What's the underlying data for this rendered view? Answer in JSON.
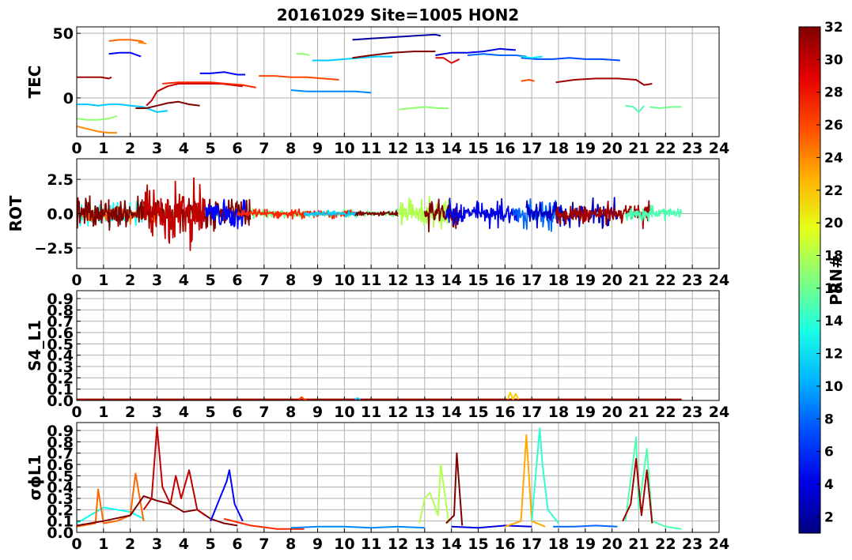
{
  "title": "20161029 Site=1005 HON2",
  "colorbar": {
    "label": "PRN#",
    "min": 1,
    "max": 32,
    "ticks": [
      "2",
      "4",
      "6",
      "8",
      "10",
      "12",
      "14",
      "16",
      "18",
      "20",
      "22",
      "24",
      "26",
      "28",
      "30",
      "32"
    ],
    "colormap": "jet"
  },
  "chart_data": [
    {
      "type": "line",
      "ylabel": "TEC",
      "xlim": [
        0,
        24
      ],
      "ylim": [
        -30,
        55
      ],
      "xticks": [
        "0",
        "1",
        "2",
        "3",
        "4",
        "5",
        "6",
        "7",
        "8",
        "9",
        "10",
        "11",
        "12",
        "13",
        "14",
        "15",
        "16",
        "17",
        "18",
        "19",
        "20",
        "21",
        "22",
        "23",
        "24"
      ],
      "yticks": [
        {
          "v": 50,
          "label": "50"
        },
        {
          "v": 0,
          "label": "0"
        }
      ],
      "grid": true,
      "series": [
        {
          "prn": 31,
          "x": [
            0.0,
            0.3,
            0.6,
            0.9,
            1.2,
            1.3
          ],
          "y": [
            16,
            16,
            16,
            16,
            15,
            16
          ]
        },
        {
          "prn": 11,
          "x": [
            0.0,
            0.4,
            0.8,
            1.2,
            1.6,
            2.0,
            2.5,
            3.0,
            3.4
          ],
          "y": [
            -5,
            -5,
            -6,
            -5,
            -5,
            -6,
            -7,
            -11,
            -10
          ]
        },
        {
          "prn": 17,
          "x": [
            0.0,
            0.4,
            0.8,
            1.2,
            1.5
          ],
          "y": [
            -16,
            -17,
            -17,
            -16,
            -14
          ]
        },
        {
          "prn": 24,
          "x": [
            0.0,
            0.4,
            0.8,
            1.2,
            1.5
          ],
          "y": [
            -22,
            -24,
            -26,
            -27,
            -27
          ]
        },
        {
          "prn": 25,
          "x": [
            1.2,
            1.6,
            2.0,
            2.4,
            2.5
          ],
          "y": [
            44,
            45,
            45,
            44,
            43
          ]
        },
        {
          "prn": 24,
          "x": [
            2.3,
            2.6
          ],
          "y": [
            43,
            42
          ]
        },
        {
          "prn": 5,
          "x": [
            1.2,
            1.6,
            2.0,
            2.4
          ],
          "y": [
            34,
            35,
            35,
            32
          ]
        },
        {
          "prn": 30,
          "x": [
            2.6,
            2.8,
            3.0,
            3.4,
            3.8,
            4.2,
            4.6,
            5.0,
            5.4,
            5.8,
            6.2
          ],
          "y": [
            -6,
            -2,
            5,
            9,
            11,
            11,
            11,
            11,
            11,
            10,
            9
          ]
        },
        {
          "prn": 32,
          "x": [
            2.2,
            2.6,
            3.0,
            3.4,
            3.8,
            4.2,
            4.6
          ],
          "y": [
            -8,
            -8,
            -6,
            -4,
            -3,
            -5,
            -6
          ]
        },
        {
          "prn": 27,
          "x": [
            3.2,
            3.8,
            4.4,
            5.0,
            5.6,
            6.2,
            6.7
          ],
          "y": [
            11,
            12,
            12,
            12,
            11,
            10,
            8
          ]
        },
        {
          "prn": 5,
          "x": [
            4.6,
            5.0,
            5.5,
            6.0,
            6.3
          ],
          "y": [
            19,
            19,
            20,
            18,
            18
          ]
        },
        {
          "prn": 26,
          "x": [
            6.8,
            7.4,
            8.0,
            8.6,
            9.2,
            9.8
          ],
          "y": [
            17,
            17,
            16,
            16,
            15,
            14
          ]
        },
        {
          "prn": 9,
          "x": [
            8.0,
            8.6,
            9.2,
            9.8,
            10.4,
            11.0
          ],
          "y": [
            6,
            5,
            5,
            5,
            5,
            4
          ]
        },
        {
          "prn": 17,
          "x": [
            8.2,
            8.5,
            8.7
          ],
          "y": [
            34,
            34,
            33
          ]
        },
        {
          "prn": 11,
          "x": [
            8.8,
            9.4,
            10.0,
            10.6,
            11.2,
            11.8
          ],
          "y": [
            29,
            29,
            30,
            31,
            32,
            32
          ]
        },
        {
          "prn": 2,
          "x": [
            10.3,
            11.0,
            11.8,
            12.6,
            13.4,
            13.6
          ],
          "y": [
            45,
            46,
            47,
            48,
            49,
            48
          ]
        },
        {
          "prn": 32,
          "x": [
            10.3,
            11.0,
            11.8,
            12.6,
            13.4
          ],
          "y": [
            31,
            33,
            35,
            36,
            36
          ]
        },
        {
          "prn": 29,
          "x": [
            13.4,
            13.7,
            14.0,
            14.3
          ],
          "y": [
            31,
            31,
            27,
            30
          ]
        },
        {
          "prn": 4,
          "x": [
            13.4,
            14.0,
            14.6,
            15.2,
            15.8,
            16.4
          ],
          "y": [
            33,
            35,
            35,
            36,
            38,
            37
          ]
        },
        {
          "prn": 8,
          "x": [
            14.6,
            15.2,
            15.8,
            16.4,
            16.8
          ],
          "y": [
            33,
            34,
            33,
            33,
            32
          ]
        },
        {
          "prn": 7,
          "x": [
            16.6,
            17.2,
            17.8,
            18.4,
            19.0,
            19.6,
            20.3
          ],
          "y": [
            31,
            30,
            30,
            31,
            30,
            30,
            29
          ]
        },
        {
          "prn": 12,
          "x": [
            16.6,
            17.0,
            17.4
          ],
          "y": [
            32,
            31,
            32
          ]
        },
        {
          "prn": 17,
          "x": [
            12.0,
            12.5,
            13.0,
            13.5,
            13.9
          ],
          "y": [
            -9,
            -8,
            -7,
            -8,
            -8
          ]
        },
        {
          "prn": 26,
          "x": [
            16.6,
            16.9,
            17.1
          ],
          "y": [
            13,
            14,
            13
          ]
        },
        {
          "prn": 31,
          "x": [
            17.9,
            18.6,
            19.4,
            20.2,
            20.9,
            21.2,
            21.5
          ],
          "y": [
            12,
            14,
            15,
            15,
            14,
            10,
            11
          ]
        },
        {
          "prn": 15,
          "x": [
            20.5,
            20.8,
            21.0,
            21.2
          ],
          "y": [
            -6,
            -7,
            -11,
            -6
          ]
        },
        {
          "prn": 16,
          "x": [
            21.4,
            21.8,
            22.2,
            22.6
          ],
          "y": [
            -7,
            -8,
            -7,
            -7
          ]
        }
      ]
    },
    {
      "type": "line",
      "ylabel": "ROT",
      "xlim": [
        0,
        24
      ],
      "ylim": [
        -4,
        4
      ],
      "xticks": [
        "0",
        "1",
        "2",
        "3",
        "4",
        "5",
        "6",
        "7",
        "8",
        "9",
        "10",
        "11",
        "12",
        "13",
        "14",
        "15",
        "16",
        "17",
        "18",
        "19",
        "20",
        "21",
        "22",
        "23",
        "24"
      ],
      "yticks": [
        {
          "v": 2.5,
          "label": "2.5"
        },
        {
          "v": 0,
          "label": "0.0"
        },
        {
          "v": -2.5,
          "label": "−2.5"
        }
      ],
      "grid": true,
      "bursts": [
        {
          "prn": 16,
          "from": 0.0,
          "to": 12.0,
          "amp": 0.4
        },
        {
          "prn": 13,
          "from": 0.0,
          "to": 2.5,
          "amp": 1.2
        },
        {
          "prn": 25,
          "from": 0.0,
          "to": 3.0,
          "amp": 0.8
        },
        {
          "prn": 32,
          "from": 0.0,
          "to": 6.5,
          "amp": 1.6
        },
        {
          "prn": 30,
          "from": 2.5,
          "to": 4.8,
          "amp": 2.8
        },
        {
          "prn": 5,
          "from": 4.8,
          "to": 6.3,
          "amp": 1.6
        },
        {
          "prn": 27,
          "from": 6.0,
          "to": 10.5,
          "amp": 0.4
        },
        {
          "prn": 11,
          "from": 8.5,
          "to": 10.5,
          "amp": 0.3
        },
        {
          "prn": 32,
          "from": 10.4,
          "to": 12.0,
          "amp": 0.3
        },
        {
          "prn": 18,
          "from": 12.0,
          "to": 14.0,
          "amp": 1.6
        },
        {
          "prn": 32,
          "from": 13.0,
          "to": 14.3,
          "amp": 1.5
        },
        {
          "prn": 4,
          "from": 13.8,
          "to": 16.5,
          "amp": 1.3
        },
        {
          "prn": 8,
          "from": 16.3,
          "to": 18.0,
          "amp": 1.6
        },
        {
          "prn": 3,
          "from": 16.8,
          "to": 20.2,
          "amp": 1.3
        },
        {
          "prn": 31,
          "from": 17.9,
          "to": 21.4,
          "amp": 1.2
        },
        {
          "prn": 15,
          "from": 20.5,
          "to": 22.6,
          "amp": 0.8
        }
      ]
    },
    {
      "type": "line",
      "ylabel": "S4_L1",
      "xlim": [
        0,
        24
      ],
      "ylim": [
        0,
        0.97
      ],
      "xticks": [
        "0",
        "1",
        "2",
        "3",
        "4",
        "5",
        "6",
        "7",
        "8",
        "9",
        "10",
        "11",
        "12",
        "13",
        "14",
        "15",
        "16",
        "17",
        "18",
        "19",
        "20",
        "21",
        "22",
        "23",
        "24"
      ],
      "yticks": [
        {
          "v": 0,
          "label": "0.0"
        },
        {
          "v": 0.1,
          "label": "0.1"
        },
        {
          "v": 0.2,
          "label": "0.2"
        },
        {
          "v": 0.3,
          "label": "0.3"
        },
        {
          "v": 0.4,
          "label": "0.4"
        },
        {
          "v": 0.5,
          "label": "0.5"
        },
        {
          "v": 0.6,
          "label": "0.6"
        },
        {
          "v": 0.7,
          "label": "0.7"
        },
        {
          "v": 0.8,
          "label": "0.8"
        },
        {
          "v": 0.9,
          "label": "0.9"
        }
      ],
      "grid": true,
      "series": [
        {
          "prn": 31,
          "x": [
            0.0,
            4.0,
            8.0,
            12.0,
            16.0,
            20.0,
            22.6
          ],
          "y": [
            0.01,
            0.01,
            0.01,
            0.01,
            0.01,
            0.01,
            0.01
          ]
        },
        {
          "prn": 26,
          "x": [
            8.3,
            8.4,
            8.5,
            8.6
          ],
          "y": [
            0.01,
            0.03,
            0.01,
            0.01
          ]
        },
        {
          "prn": 11,
          "x": [
            10.4,
            10.5,
            10.6
          ],
          "y": [
            0.01,
            0.02,
            0.01
          ]
        },
        {
          "prn": 22,
          "x": [
            16.1,
            16.2,
            16.3,
            16.4,
            16.5
          ],
          "y": [
            0.01,
            0.07,
            0.01,
            0.06,
            0.01
          ]
        }
      ]
    },
    {
      "type": "line",
      "ylabel": "σϕL1",
      "xlim": [
        0,
        24
      ],
      "ylim": [
        0,
        0.97
      ],
      "xticks": [
        "0",
        "1",
        "2",
        "3",
        "4",
        "5",
        "6",
        "7",
        "8",
        "9",
        "10",
        "11",
        "12",
        "13",
        "14",
        "15",
        "16",
        "17",
        "18",
        "19",
        "20",
        "21",
        "22",
        "23",
        "24"
      ],
      "yticks": [
        {
          "v": 0,
          "label": "0.0"
        },
        {
          "v": 0.1,
          "label": "0.1"
        },
        {
          "v": 0.2,
          "label": "0.2"
        },
        {
          "v": 0.3,
          "label": "0.3"
        },
        {
          "v": 0.4,
          "label": "0.4"
        },
        {
          "v": 0.5,
          "label": "0.5"
        },
        {
          "v": 0.6,
          "label": "0.6"
        },
        {
          "v": 0.7,
          "label": "0.7"
        },
        {
          "v": 0.8,
          "label": "0.8"
        },
        {
          "v": 0.9,
          "label": "0.9"
        }
      ],
      "grid": true,
      "series": [
        {
          "prn": 13,
          "x": [
            0.0,
            0.5,
            1.0,
            1.5,
            2.0,
            2.5
          ],
          "y": [
            0.08,
            0.15,
            0.22,
            0.2,
            0.18,
            0.12
          ]
        },
        {
          "prn": 25,
          "x": [
            0.0,
            0.7,
            0.8,
            1.0,
            1.5,
            2.0,
            2.2,
            2.5
          ],
          "y": [
            0.05,
            0.08,
            0.38,
            0.08,
            0.1,
            0.15,
            0.52,
            0.1
          ]
        },
        {
          "prn": 32,
          "x": [
            0.0,
            1.0,
            2.0,
            2.5,
            3.0,
            3.5,
            4.0,
            4.5,
            5.0,
            5.5,
            6.0
          ],
          "y": [
            0.06,
            0.1,
            0.15,
            0.32,
            0.28,
            0.25,
            0.18,
            0.2,
            0.12,
            0.08,
            0.06
          ]
        },
        {
          "prn": 30,
          "x": [
            2.5,
            2.8,
            3.0,
            3.2,
            3.5,
            3.7,
            3.9,
            4.2,
            4.5,
            4.8
          ],
          "y": [
            0.2,
            0.3,
            0.93,
            0.4,
            0.25,
            0.5,
            0.3,
            0.55,
            0.2,
            0.15
          ]
        },
        {
          "prn": 5,
          "x": [
            5.0,
            5.6,
            5.7,
            5.9,
            6.2
          ],
          "y": [
            0.1,
            0.45,
            0.55,
            0.25,
            0.1
          ]
        },
        {
          "prn": 27,
          "x": [
            5.5,
            6.5,
            7.5,
            8.5
          ],
          "y": [
            0.12,
            0.06,
            0.03,
            0.03
          ]
        },
        {
          "prn": 9,
          "x": [
            8.0,
            9.0,
            10.0,
            11.0,
            12.0,
            13.0
          ],
          "y": [
            0.04,
            0.05,
            0.05,
            0.04,
            0.05,
            0.04
          ]
        },
        {
          "prn": 18,
          "x": [
            12.8,
            13.0,
            13.2,
            13.5,
            13.6,
            13.9
          ],
          "y": [
            0.08,
            0.3,
            0.35,
            0.15,
            0.6,
            0.08
          ]
        },
        {
          "prn": 32,
          "x": [
            13.8,
            14.1,
            14.2,
            14.4
          ],
          "y": [
            0.08,
            0.15,
            0.7,
            0.06
          ]
        },
        {
          "prn": 4,
          "x": [
            14.0,
            15.0,
            16.0,
            17.0
          ],
          "y": [
            0.05,
            0.04,
            0.06,
            0.05
          ]
        },
        {
          "prn": 23,
          "x": [
            16.0,
            16.6,
            16.8,
            17.0,
            17.5
          ],
          "y": [
            0.05,
            0.1,
            0.86,
            0.1,
            0.05
          ]
        },
        {
          "prn": 14,
          "x": [
            17.0,
            17.3,
            17.4,
            17.6,
            18.0
          ],
          "y": [
            0.1,
            0.92,
            0.6,
            0.2,
            0.08
          ]
        },
        {
          "prn": 8,
          "x": [
            17.8,
            18.6,
            19.4,
            20.2
          ],
          "y": [
            0.05,
            0.05,
            0.06,
            0.05
          ]
        },
        {
          "prn": 15,
          "x": [
            20.5,
            20.9,
            21.0,
            21.3,
            21.5,
            22.0,
            22.6
          ],
          "y": [
            0.1,
            0.84,
            0.2,
            0.74,
            0.1,
            0.05,
            0.03
          ]
        },
        {
          "prn": 31,
          "x": [
            20.4,
            20.7,
            20.9,
            21.1,
            21.3,
            21.5
          ],
          "y": [
            0.1,
            0.25,
            0.65,
            0.15,
            0.55,
            0.08
          ]
        }
      ]
    }
  ]
}
